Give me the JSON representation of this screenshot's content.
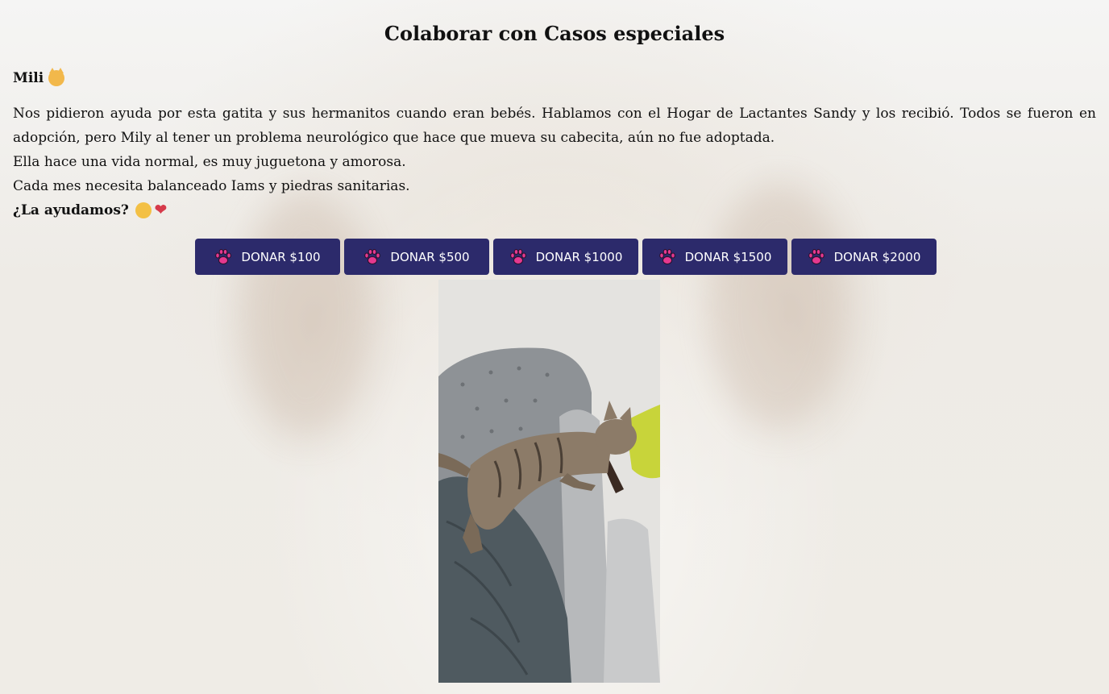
{
  "page": {
    "title": "Colaborar con Casos especiales"
  },
  "case": {
    "name": "Mili",
    "name_emoji": "cat-face-icon",
    "paragraphs": [
      "Nos pidieron ayuda por esta gatita y sus hermanitos cuando eran bebés. Hablamos con el Hogar de Lactantes Sandy y los recibió. Todos se fueron en adopción, pero Mily al tener un problema neurológico que hace que mueva su cabecita, aún no fue adoptada.",
      "Ella hace una vida normal, es muy juguetona y amorosa.",
      "Cada mes necesita balanceado Iams y piedras sanitarias."
    ],
    "question": "¿La ayudamos?",
    "question_emojis": [
      "raising-hands-icon",
      "heart-icon"
    ]
  },
  "donate_buttons": [
    {
      "label": "DONAR $100",
      "icon": "paw-icon"
    },
    {
      "label": "DONAR $500",
      "icon": "paw-icon"
    },
    {
      "label": "DONAR $1000",
      "icon": "paw-icon"
    },
    {
      "label": "DONAR $1500",
      "icon": "paw-icon"
    },
    {
      "label": "DONAR $2000",
      "icon": "paw-icon"
    }
  ],
  "colors": {
    "button_bg": "#2c2a6b",
    "button_text": "#ffffff",
    "paw": "#e5398f",
    "text": "#111111"
  }
}
